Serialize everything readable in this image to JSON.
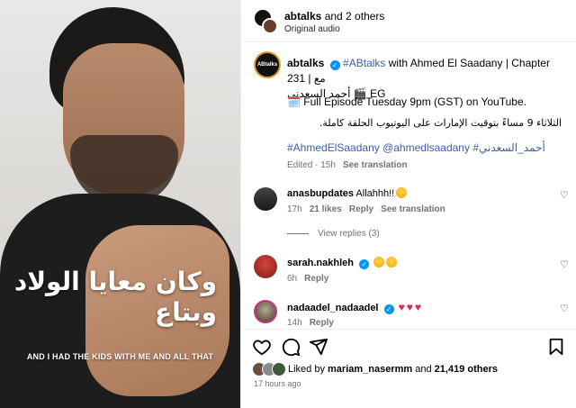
{
  "media": {
    "subtitle_ar": "وكان معايا الولاد وبتاع",
    "subtitle_en": "AND I HAD THE KIDS WITH ME AND ALL THAT"
  },
  "header": {
    "owner": "abtalks",
    "owner_suffix": " and 2 others",
    "subtitle": "Original audio"
  },
  "post": {
    "avatar_text": "ABtalks",
    "username": "abtalks",
    "hashtag": "#ABtalks",
    "caption_rest": " with Ahmed El Saadany | Chapter 231 | مع",
    "caption_line2": "أحمد السعدني 🎬 EG",
    "episode": "🗓️ Full Episode Tuesday 9pm (GST) on YouTube.",
    "arabic_episode": "الثلاثاء 9 مساءً بتوقيت الإمارات على اليوتيوب الحلقة كاملة.",
    "tags": "#AhmedElSaadany @ahmedlsaadany #أحمد_السعدني",
    "edited": "Edited · 15h",
    "see_translation": "See translation"
  },
  "comments": [
    {
      "user": "anasbupdates",
      "text": "Allahhh!!",
      "time": "17h",
      "likes": "21 likes",
      "reply": "Reply",
      "translate": "See translation"
    },
    {
      "user": "sarah.nakhleh",
      "text": "",
      "time": "6h",
      "reply": "Reply"
    },
    {
      "user": "nadaadel_nadaadel",
      "text": "",
      "time": "14h",
      "reply": "Reply"
    }
  ],
  "view_replies": "View replies (3)",
  "likes": {
    "prefix": "Liked by ",
    "user": "mariam_nasermm",
    "and": " and ",
    "others": "21,419 others"
  },
  "time_ago": "17 hours ago",
  "colors": {
    "accent_link": "#3a5ea8",
    "verified": "#0095f6",
    "heart": "#e0245e"
  }
}
